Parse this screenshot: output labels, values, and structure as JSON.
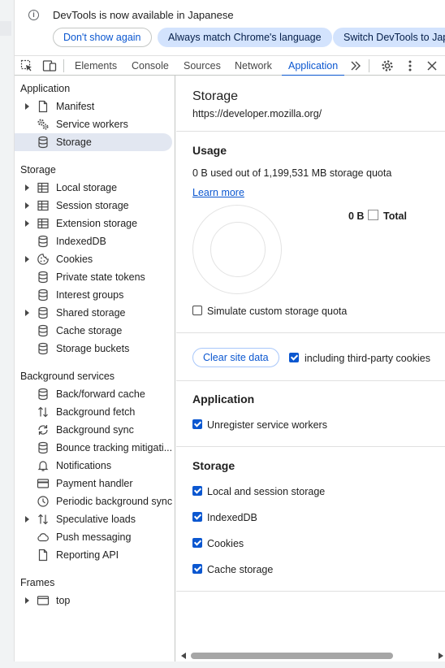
{
  "infobar": {
    "message": "DevTools is now available in Japanese",
    "dont_show": "Don't show again",
    "always_match": "Always match Chrome's language",
    "switch": "Switch DevTools to Japa"
  },
  "tabs": [
    {
      "label": "Elements"
    },
    {
      "label": "Console"
    },
    {
      "label": "Sources"
    },
    {
      "label": "Network"
    },
    {
      "label": "Application"
    }
  ],
  "sidebar": {
    "application_header": "Application",
    "application_items": [
      {
        "label": "Manifest",
        "icon": "document-icon"
      },
      {
        "label": "Service workers",
        "icon": "gears-icon"
      },
      {
        "label": "Storage",
        "icon": "database-icon"
      }
    ],
    "storage_header": "Storage",
    "storage_items": [
      {
        "label": "Local storage",
        "icon": "table-icon"
      },
      {
        "label": "Session storage",
        "icon": "table-icon"
      },
      {
        "label": "Extension storage",
        "icon": "table-icon"
      },
      {
        "label": "IndexedDB",
        "icon": "database-icon"
      },
      {
        "label": "Cookies",
        "icon": "cookie-icon"
      },
      {
        "label": "Private state tokens",
        "icon": "database-icon"
      },
      {
        "label": "Interest groups",
        "icon": "database-icon"
      },
      {
        "label": "Shared storage",
        "icon": "database-icon"
      },
      {
        "label": "Cache storage",
        "icon": "database-icon"
      },
      {
        "label": "Storage buckets",
        "icon": "database-icon"
      }
    ],
    "background_header": "Background services",
    "background_items": [
      {
        "label": "Back/forward cache",
        "icon": "database-icon"
      },
      {
        "label": "Background fetch",
        "icon": "up-down-arrows-icon"
      },
      {
        "label": "Background sync",
        "icon": "sync-icon"
      },
      {
        "label": "Bounce tracking mitigati...",
        "icon": "database-icon"
      },
      {
        "label": "Notifications",
        "icon": "bell-icon"
      },
      {
        "label": "Payment handler",
        "icon": "credit-card-icon"
      },
      {
        "label": "Periodic background sync",
        "icon": "clock-icon"
      },
      {
        "label": "Speculative loads",
        "icon": "up-down-arrows-icon"
      },
      {
        "label": "Push messaging",
        "icon": "cloud-icon"
      },
      {
        "label": "Reporting API",
        "icon": "document-icon"
      }
    ],
    "frames_header": "Frames",
    "frames_items": [
      {
        "label": "top",
        "icon": "frame-icon"
      }
    ]
  },
  "main": {
    "title": "Storage",
    "url": "https://developer.mozilla.org/",
    "usage_header": "Usage",
    "usage_text": "0 B used out of 1,199,531 MB storage quota",
    "learn_more": "Learn more",
    "legend_value": "0 B",
    "legend_label": "Total",
    "usage_fraction": 0,
    "simulate_label": "Simulate custom storage quota",
    "clear_button": "Clear site data",
    "third_party_label": "including third-party cookies",
    "application_header": "Application",
    "unregister_label": "Unregister service workers",
    "storage_header": "Storage",
    "storage_checks": [
      {
        "label": "Local and session storage"
      },
      {
        "label": "IndexedDB"
      },
      {
        "label": "Cookies"
      },
      {
        "label": "Cache storage"
      }
    ]
  },
  "colors": {
    "accent": "#0b57d0",
    "selected_bg": "#e2e7f1",
    "chip_bg": "#d3e3fd"
  }
}
